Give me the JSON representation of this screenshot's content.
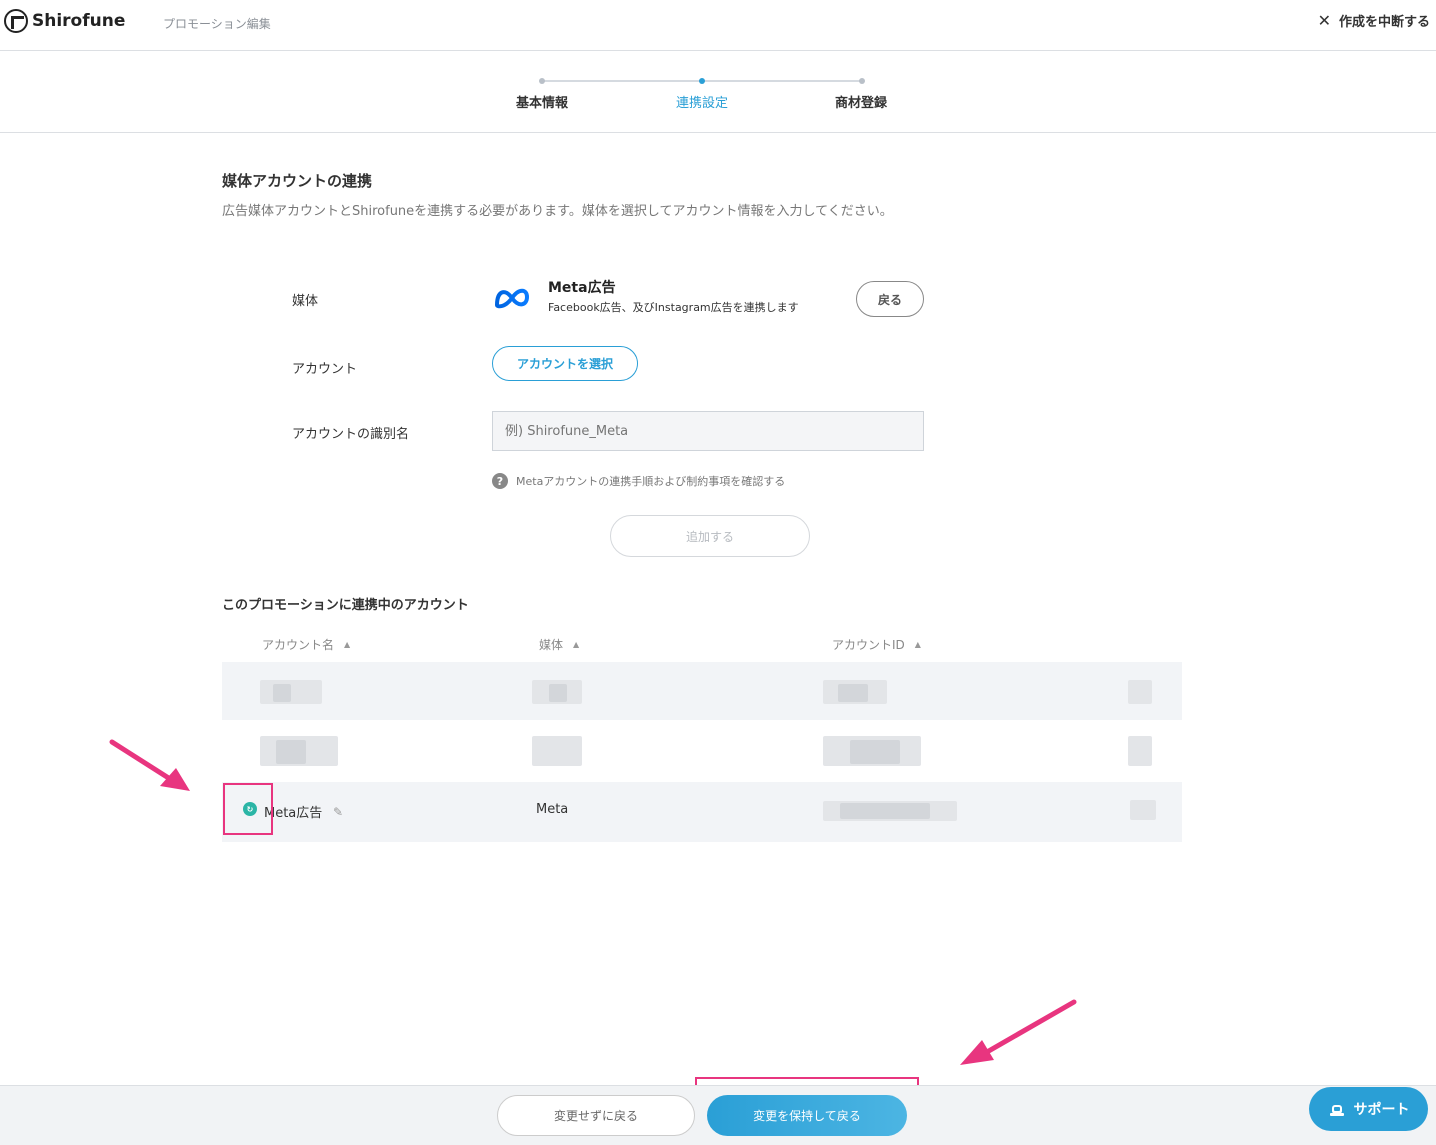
{
  "header": {
    "logo_text": "Shirofune",
    "page_label": "プロモーション編集",
    "abort_label": "作成を中断する"
  },
  "stepper": {
    "steps": [
      {
        "label": "基本情報",
        "active": false
      },
      {
        "label": "連携設定",
        "active": true
      },
      {
        "label": "商材登録",
        "active": false
      }
    ]
  },
  "section": {
    "title": "媒体アカウントの連携",
    "description": "広告媒体アカウントとShirofuneを連携する必要があります。媒体を選択してアカウント情報を入力してください。"
  },
  "form": {
    "media_label": "媒体",
    "media_name": "Meta広告",
    "media_desc": "Facebook広告、及びInstagram広告を連携します",
    "back_button": "戻る",
    "account_label": "アカウント",
    "select_account_button": "アカウントを選択",
    "alias_label": "アカウントの識別名",
    "alias_placeholder": "例) Shirofune_Meta",
    "help_text": "Metaアカウントの連携手順および制約事項を確認する",
    "add_button": "追加する"
  },
  "table": {
    "title": "このプロモーションに連携中のアカウント",
    "columns": [
      "アカウント名",
      "媒体",
      "アカウントID"
    ],
    "rows": [
      {
        "account_name": "",
        "media": "",
        "account_id": ""
      },
      {
        "account_name": "",
        "media": "",
        "account_id": ""
      },
      {
        "account_name": "Meta広告",
        "media": "Meta",
        "account_id": ""
      }
    ]
  },
  "footer": {
    "discard_button": "変更せずに戻る",
    "keep_button": "変更を保持して戻る",
    "support_button": "サポート"
  },
  "colors": {
    "accent": "#2a9fd6",
    "annotation": "#e8357f",
    "status_ok": "#2bb5a6"
  }
}
